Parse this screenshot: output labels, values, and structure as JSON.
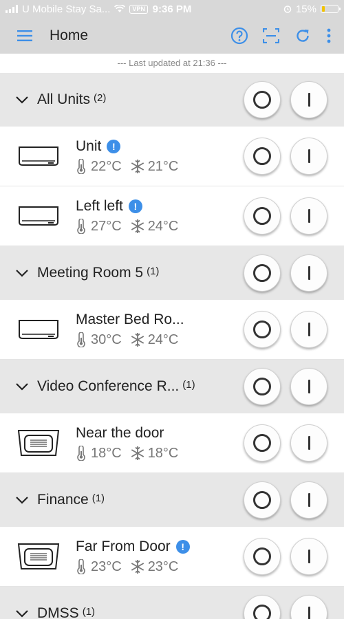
{
  "status_bar": {
    "carrier": "U Mobile Stay Sa...",
    "vpn": "VPN",
    "time": "9:36 PM",
    "battery": "15%"
  },
  "app_bar": {
    "title": "Home",
    "icons": [
      "menu-icon",
      "help-icon",
      "scan-icon",
      "refresh-icon",
      "more-vertical-icon"
    ],
    "accent_color": "#3d8fe8"
  },
  "last_updated": "--- Last updated at 21:36 ---",
  "groups": [
    {
      "name": "All Units",
      "count": "(2)",
      "units": [
        {
          "name": "Unit",
          "alert": true,
          "type": "wall",
          "room_temp": "22°C",
          "set_temp": "21°C"
        },
        {
          "name": "Left left",
          "alert": true,
          "type": "wall",
          "room_temp": "27°C",
          "set_temp": "24°C"
        }
      ]
    },
    {
      "name": "Meeting Room 5",
      "count": "(1)",
      "units": [
        {
          "name": "Master Bed Ro...",
          "alert": false,
          "type": "wall",
          "room_temp": "30°C",
          "set_temp": "24°C"
        }
      ]
    },
    {
      "name": "Video Conference R...",
      "count": "(1)",
      "units": [
        {
          "name": "Near the door",
          "alert": false,
          "type": "cassette",
          "room_temp": "18°C",
          "set_temp": "18°C"
        }
      ]
    },
    {
      "name": "Finance",
      "count": "(1)",
      "units": [
        {
          "name": "Far From Door",
          "alert": true,
          "type": "cassette",
          "room_temp": "23°C",
          "set_temp": "23°C"
        }
      ]
    },
    {
      "name": "DMSS",
      "count": "(1)",
      "units": []
    }
  ]
}
